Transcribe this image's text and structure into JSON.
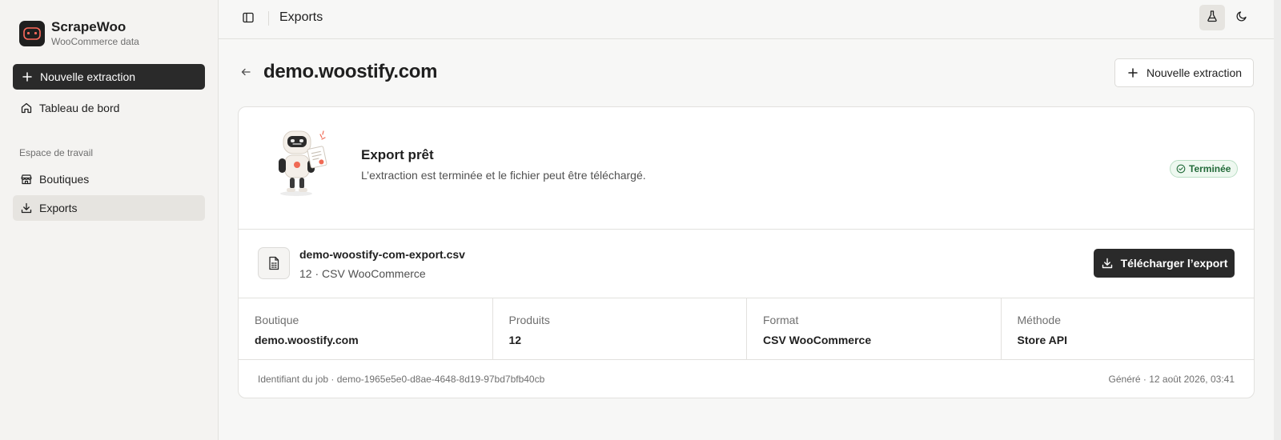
{
  "brand": {
    "name": "ScrapeWoo",
    "subtitle": "WooCommerce data"
  },
  "sidebar": {
    "new_extraction_label": "Nouvelle extraction",
    "dashboard_label": "Tableau de bord",
    "section_label": "Espace de travail",
    "items": [
      {
        "label": "Boutiques",
        "icon": "store-icon",
        "active": false
      },
      {
        "label": "Exports",
        "icon": "download-icon",
        "active": true
      }
    ]
  },
  "topbar": {
    "title": "Exports"
  },
  "page": {
    "title": "demo.woostify.com",
    "new_extraction_label": "Nouvelle extraction"
  },
  "export": {
    "ready_title": "Export prêt",
    "ready_description": "L’extraction est terminée et le fichier peut être téléchargé.",
    "status": "Terminée",
    "status_color": "#236b3a",
    "file_name": "demo-woostify-com-export.csv",
    "file_meta": "12 · CSV WooCommerce",
    "download_label": "Télécharger l’export"
  },
  "stats": [
    {
      "label": "Boutique",
      "value": "demo.woostify.com"
    },
    {
      "label": "Produits",
      "value": "12"
    },
    {
      "label": "Format",
      "value": "CSV WooCommerce"
    },
    {
      "label": "Méthode",
      "value": "Store API"
    }
  ],
  "footer": {
    "job_id": "Identifiant du job · demo-1965e5e0-d8ae-4648-8d19-97bd7bfb40cb",
    "generated": "Généré · 12 août 2026, 03:41"
  },
  "colors": {
    "primary_button": "#2a2a2a",
    "accent_badge_bg": "#eef8f0"
  }
}
